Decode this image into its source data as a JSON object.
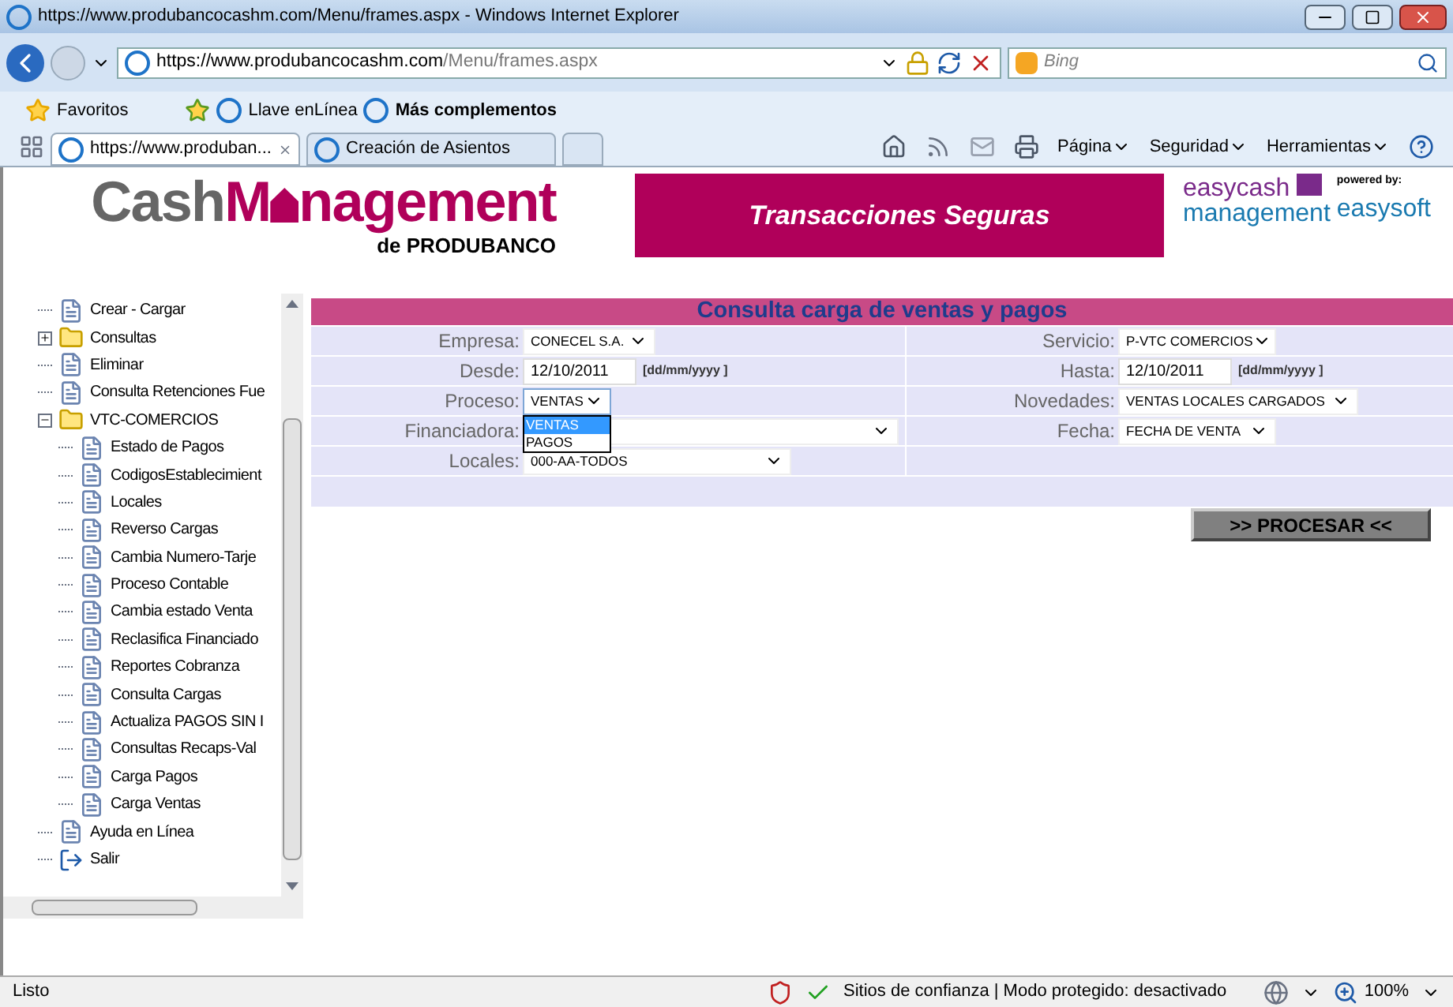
{
  "window": {
    "title": "https://www.produbancocashm.com/Menu/frames.aspx - Windows Internet Explorer"
  },
  "address_bar": {
    "url_scheme": "https://",
    "url_host": "www.produbancocashm.com",
    "url_path": "/Menu/frames.aspx"
  },
  "search": {
    "placeholder": "Bing"
  },
  "favorites_bar": {
    "favorites": "Favoritos",
    "links": [
      {
        "label": "Llave enLínea",
        "bold": false
      },
      {
        "label": "Más complementos",
        "bold": true
      }
    ]
  },
  "tabs": [
    {
      "label": "https://www.produban...",
      "selected": true
    },
    {
      "label": "Creación de Asientos",
      "selected": false
    }
  ],
  "command_bar": [
    "Página",
    "Seguridad",
    "Herramientas"
  ],
  "header": {
    "logo_part1": "CashM",
    "logo_part2": "nagement",
    "logo_sub": "de PRODUBANCO",
    "banner": "Transacciones Seguras",
    "partner_top": "easycash",
    "partner_bottom": "management",
    "powered": "powered by:",
    "powered_brand": "easysoft"
  },
  "tree": [
    {
      "kind": "page",
      "label": "Crear - Cargar"
    },
    {
      "kind": "folder",
      "label": "Consultas",
      "expanded": false
    },
    {
      "kind": "page",
      "label": "Eliminar"
    },
    {
      "kind": "page",
      "label": "Consulta Retenciones Fue"
    },
    {
      "kind": "folder",
      "label": "VTC-COMERCIOS",
      "expanded": true,
      "children": [
        {
          "kind": "page",
          "label": "Estado de Pagos"
        },
        {
          "kind": "page",
          "label": "CodigosEstablecimient"
        },
        {
          "kind": "page",
          "label": "Locales"
        },
        {
          "kind": "page",
          "label": "Reverso Cargas"
        },
        {
          "kind": "page",
          "label": "Cambia Numero-Tarje"
        },
        {
          "kind": "page",
          "label": "Proceso Contable"
        },
        {
          "kind": "page",
          "label": "Cambia estado Venta"
        },
        {
          "kind": "page",
          "label": "Reclasifica Financiado"
        },
        {
          "kind": "page",
          "label": "Reportes Cobranza"
        },
        {
          "kind": "page",
          "label": "Consulta Cargas"
        },
        {
          "kind": "page",
          "label": "Actualiza PAGOS SIN I"
        },
        {
          "kind": "page",
          "label": "Consultas Recaps-Val"
        },
        {
          "kind": "page",
          "label": "Carga Pagos"
        },
        {
          "kind": "page",
          "label": "Carga Ventas"
        }
      ]
    },
    {
      "kind": "page",
      "label": "Ayuda en Línea"
    },
    {
      "kind": "exit",
      "label": "Salir"
    }
  ],
  "form": {
    "title": "Consulta carga de ventas y pagos",
    "rows": [
      {
        "left": {
          "label": "Empresa:",
          "kind": "select",
          "value": "CONECEL S.A."
        },
        "right": {
          "label": "Servicio:",
          "kind": "select",
          "value": "P-VTC COMERCIOS"
        }
      },
      {
        "left": {
          "label": "Desde:",
          "kind": "date",
          "value": "12/10/2011",
          "hint": "[dd/mm/yyyy ]"
        },
        "right": {
          "label": "Hasta:",
          "kind": "date",
          "value": "12/10/2011",
          "hint": "[dd/mm/yyyy ]"
        }
      },
      {
        "left": {
          "label": "Proceso:",
          "kind": "select",
          "value": "VENTAS",
          "open": true,
          "options": [
            {
              "label": "VENTAS",
              "selected": true
            },
            {
              "label": "PAGOS",
              "selected": false
            }
          ]
        },
        "right": {
          "label": "Novedades:",
          "kind": "select",
          "value": "VENTAS LOCALES CARGADOS"
        }
      },
      {
        "left": {
          "label": "Financiadora:",
          "kind": "select"
        },
        "right": {
          "label": "Fecha:",
          "kind": "select",
          "value": "FECHA DE VENTA"
        }
      },
      {
        "left": {
          "label": "Locales:",
          "kind": "select",
          "value": "000-AA-TODOS"
        }
      }
    ],
    "button": ">> PROCESAR <<"
  },
  "status_bar": {
    "text": "Listo",
    "zone": "Sitios de confianza | Modo protegido: desactivado",
    "zoom": "100%"
  }
}
